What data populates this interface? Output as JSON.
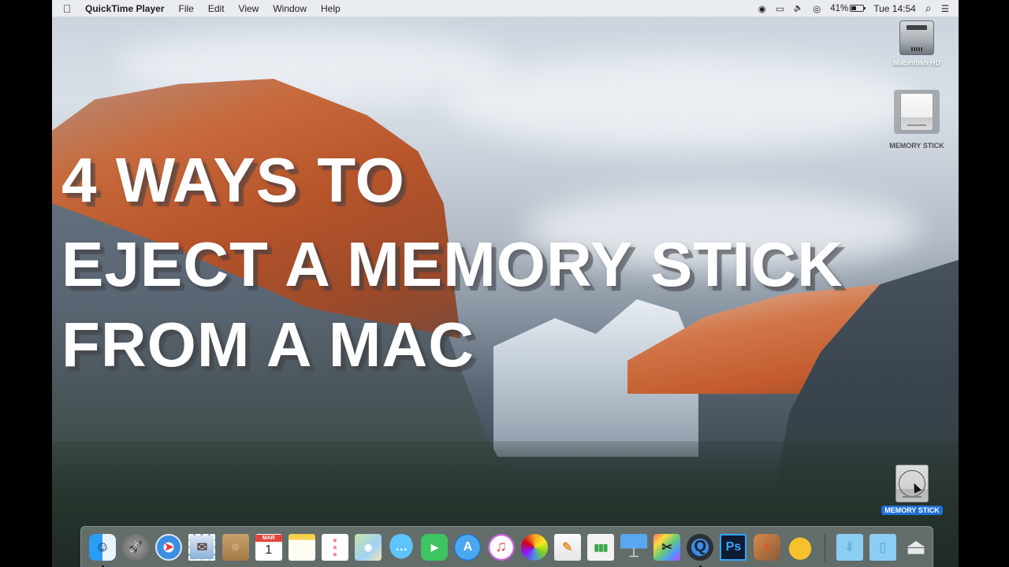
{
  "menubar": {
    "apple_icon": "",
    "app_name": "QuickTime Player",
    "menus": [
      "File",
      "Edit",
      "View",
      "Window",
      "Help"
    ],
    "status": {
      "screen_record_icon": "◉",
      "airplay_icon": "▭",
      "volume_icon": "🔈",
      "wifi_icon": "◎",
      "battery_percent": "41%",
      "clock": "Tue 14:54",
      "spotlight_icon": "⌕",
      "notification_center_icon": "☰"
    }
  },
  "overlay_title": {
    "line1": "4 WAYS TO",
    "line2": "EJECT A MEMORY STICK",
    "line3": "FROM A MAC"
  },
  "desktop_icons": [
    {
      "label": "Macintosh HD",
      "type": "hard-drive",
      "selected": false
    },
    {
      "label": "MEMORY STICK",
      "type": "external-drive",
      "selected": true
    },
    {
      "label": "MEMORY STICK",
      "type": "external-drive-dragging",
      "selected": true
    }
  ],
  "dock": {
    "apps": [
      {
        "name": "Finder",
        "running": true,
        "glyph": "☺"
      },
      {
        "name": "Launchpad",
        "running": false,
        "glyph": "🚀"
      },
      {
        "name": "Safari",
        "running": false,
        "glyph": "➤"
      },
      {
        "name": "Mail",
        "running": false,
        "glyph": "✉"
      },
      {
        "name": "Contacts",
        "running": false,
        "glyph": "☻"
      },
      {
        "name": "Calendar",
        "running": false,
        "month": "MAR",
        "day": "1"
      },
      {
        "name": "Notes",
        "running": false,
        "glyph": ""
      },
      {
        "name": "Reminders",
        "running": false,
        "glyph": "●●●"
      },
      {
        "name": "Maps",
        "running": false,
        "glyph": "◉"
      },
      {
        "name": "Messages",
        "running": false,
        "glyph": "…"
      },
      {
        "name": "FaceTime",
        "running": false,
        "glyph": "▶"
      },
      {
        "name": "App Store",
        "running": false,
        "glyph": "A"
      },
      {
        "name": "iTunes",
        "running": false,
        "glyph": "♫"
      },
      {
        "name": "Photos",
        "running": false,
        "glyph": ""
      },
      {
        "name": "Pages",
        "running": false,
        "glyph": "✎"
      },
      {
        "name": "Numbers",
        "running": false,
        "glyph": "▮▮▮"
      },
      {
        "name": "Keynote",
        "running": false,
        "glyph": "⊥"
      },
      {
        "name": "Final Cut Pro",
        "running": false,
        "glyph": "✂"
      },
      {
        "name": "QuickTime Player",
        "running": true,
        "glyph": "Q"
      },
      {
        "name": "Photoshop",
        "running": false,
        "glyph": "Ps"
      },
      {
        "name": "Hype",
        "running": false,
        "glyph": "5"
      },
      {
        "name": "Cyberduck",
        "running": false,
        "glyph": "🦆"
      }
    ],
    "stacks": [
      {
        "name": "Downloads",
        "glyph": "⬇"
      },
      {
        "name": "Documents",
        "glyph": "▯"
      },
      {
        "name": "Eject",
        "glyph": "⏏"
      }
    ]
  }
}
